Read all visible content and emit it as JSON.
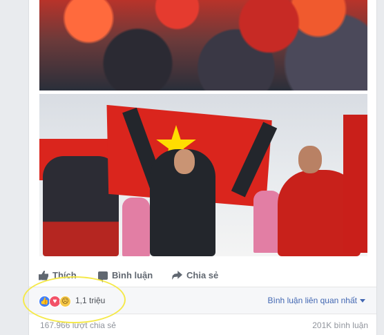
{
  "actions": {
    "like_label": "Thích",
    "comment_label": "Bình luận",
    "share_label": "Chia sẻ"
  },
  "reactions": {
    "icons": [
      "like-icon",
      "love-icon",
      "sad-icon"
    ],
    "count": "1,1 triệu"
  },
  "comments_sort": {
    "label": "Bình luận liên quan nhất"
  },
  "footer": {
    "shares": "167.966 lượt chia sẻ",
    "comments": "201K bình luận"
  },
  "colors": {
    "link": "#4267b2",
    "like_blue": "#4080ff",
    "love_red": "#f25268",
    "sad_yellow": "#f7c948",
    "highlight": "#f5e94a"
  }
}
